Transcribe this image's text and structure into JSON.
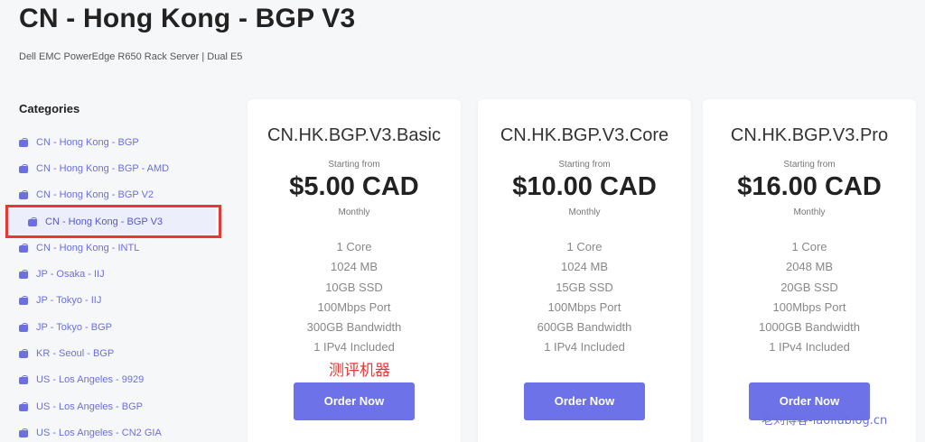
{
  "header": {
    "title": "CN - Hong Kong - BGP V3",
    "subtitle": "Dell EMC PowerEdge R650 Rack Server | Dual E5"
  },
  "sidebar": {
    "heading": "Categories",
    "icon": "bag-icon",
    "items": [
      {
        "label": "CN - Hong Kong - BGP"
      },
      {
        "label": "CN - Hong Kong - BGP - AMD"
      },
      {
        "label": "CN - Hong Kong - BGP V2"
      },
      {
        "label": "CN - Hong Kong - BGP V3",
        "active": true
      },
      {
        "label": "CN - Hong Kong - INTL"
      },
      {
        "label": "JP - Osaka - IIJ"
      },
      {
        "label": "JP - Tokyo - IIJ"
      },
      {
        "label": "JP - Tokyo - BGP"
      },
      {
        "label": "KR - Seoul - BGP"
      },
      {
        "label": "US - Los Angeles - 9929"
      },
      {
        "label": "US - Los Angeles - BGP"
      },
      {
        "label": "US - Los Angeles - CN2 GIA"
      }
    ]
  },
  "products": [
    {
      "name": "CN.HK.BGP.V3.Basic",
      "starting": "Starting from",
      "price": "$5.00 CAD",
      "period": "Monthly",
      "specs": [
        "1 Core",
        "1024 MB",
        "10GB SSD",
        "100Mbps Port",
        "300GB Bandwidth",
        "1 IPv4 Included"
      ],
      "button": "Order Now"
    },
    {
      "name": "CN.HK.BGP.V3.Core",
      "starting": "Starting from",
      "price": "$10.00 CAD",
      "period": "Monthly",
      "specs": [
        "1 Core",
        "1024 MB",
        "15GB SSD",
        "100Mbps Port",
        "600GB Bandwidth",
        "1 IPv4 Included"
      ],
      "button": "Order Now"
    },
    {
      "name": "CN.HK.BGP.V3.Pro",
      "starting": "Starting from",
      "price": "$16.00 CAD",
      "period": "Monthly",
      "specs": [
        "1 Core",
        "2048 MB",
        "20GB SSD",
        "100Mbps Port",
        "1000GB Bandwidth",
        "1 IPv4 Included"
      ],
      "button": "Order Now"
    }
  ],
  "watermarks": {
    "center": "测评机器",
    "corner": "老刘博客-laoliublog.cn"
  },
  "colors": {
    "accent": "#6d72e8",
    "highlight": "#e53935"
  }
}
